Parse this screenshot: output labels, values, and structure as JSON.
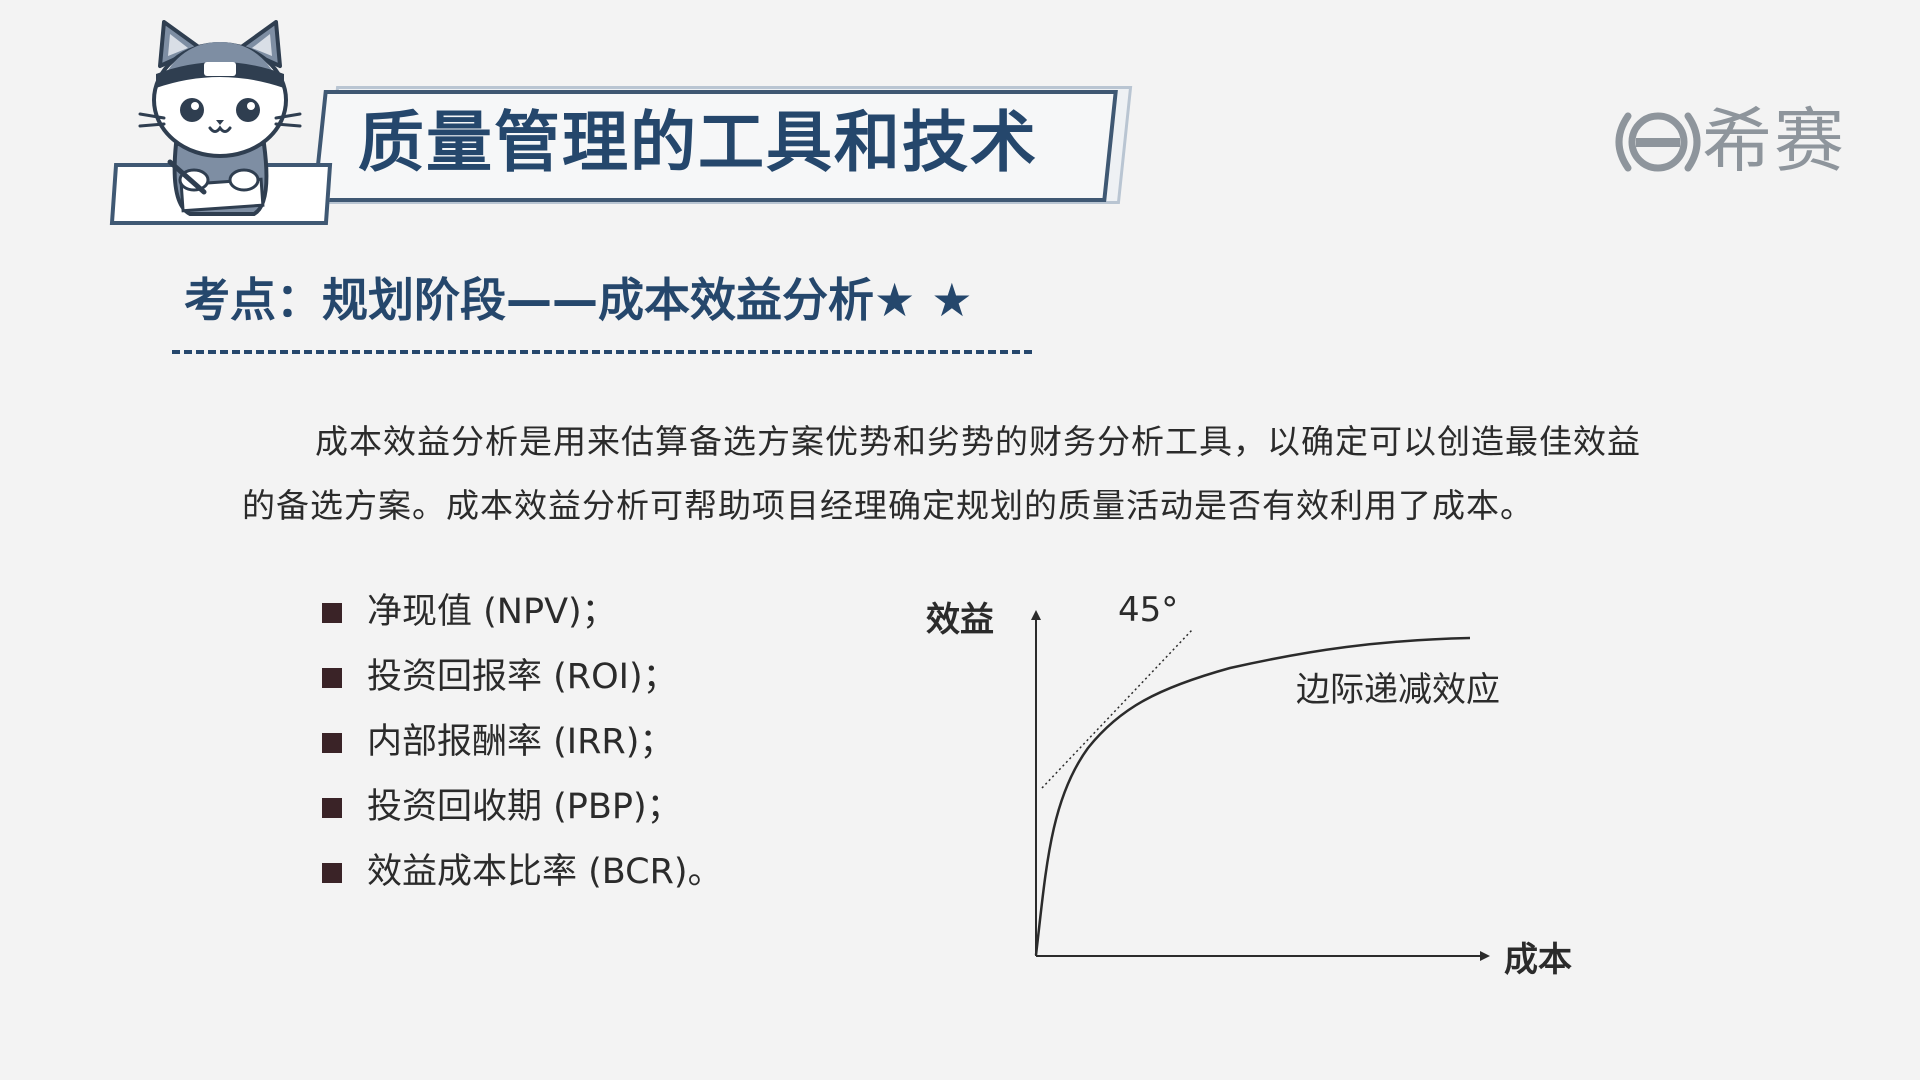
{
  "header": {
    "title": "质量管理的工具和技术"
  },
  "logo": {
    "text": "希赛",
    "color": "#8e959c"
  },
  "section": {
    "heading": "考点：规划阶段——成本效益分析★ ★"
  },
  "intro": {
    "paragraph": "成本效益分析是用来估算备选方案优势和劣势的财务分析工具，以确定可以创造最佳效益的备选方案。成本效益分析可帮助项目经理确定规划的质量活动是否有效利用了成本。"
  },
  "bullets": [
    {
      "label": "净现值 (NPV)；"
    },
    {
      "label": "投资回报率 (ROI)；"
    },
    {
      "label": "内部报酬率 (IRR)；"
    },
    {
      "label": "投资回收期 (PBP)；"
    },
    {
      "label": "效益成本比率 (BCR)。"
    }
  ],
  "diagram": {
    "y_axis_label": "效益",
    "x_axis_label": "成本",
    "angle_label": "45°",
    "curve_label": "边际递减效应"
  },
  "colors": {
    "primary": "#25476c",
    "text": "#2b2b2b",
    "background": "#f3f3f3",
    "bullet": "#3a2327"
  }
}
